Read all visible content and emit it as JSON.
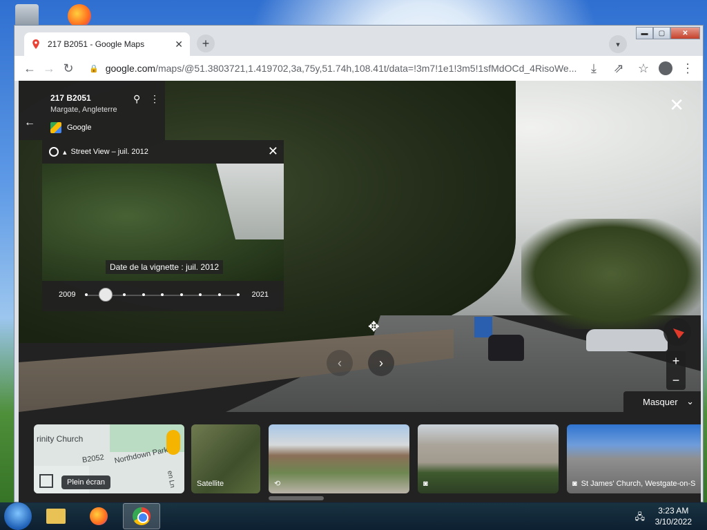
{
  "browser": {
    "tab_title": "217 B2051 - Google Maps",
    "tab_close": "✕",
    "new_tab": "+",
    "tab_search": "▾",
    "url_host": "google.com",
    "url_path": "/maps/@51.3803721,1.419702,3a,75y,51.74h,108.41t/data=!3m7!1e1!3m5!1sfMdOCd_4RisoWe...",
    "back": "←",
    "forward": "→",
    "reload": "↻",
    "lock": "🔒",
    "install": "⤓",
    "share": "⇗",
    "bookmark": "☆",
    "menu": "⋮",
    "win_min": "▬",
    "win_max": "▢",
    "win_close": "✕"
  },
  "info_panel": {
    "address": "217 B2051",
    "city": "Margate, Angleterre",
    "source": "Google",
    "back": "←",
    "pin": "⚲",
    "more": "⋮"
  },
  "timeline": {
    "header": "Street View – juil. 2012",
    "caret": "▴",
    "close": "✕",
    "caption": "Date de la vignette : juil. 2012",
    "year_start": "2009",
    "year_end": "2021",
    "dot_count": 9,
    "selected_index": 1
  },
  "viewer": {
    "close": "✕",
    "move": "✥",
    "prev": "‹",
    "next": "›",
    "zoom_in": "+",
    "zoom_out": "−",
    "hide_label": "Masquer",
    "hide_icon": "⌄"
  },
  "strip": {
    "map_label1": "rinity Church",
    "map_label2": "B2052",
    "map_label3": "Northdown Park R",
    "map_label4": "en Ln",
    "fullscreen_tooltip": "Plein écran",
    "satellite_label": "Satellite",
    "photo3_label": "St James' Church, Westgate-on-S",
    "camera": "◙",
    "pano360": "⟲"
  },
  "taskbar": {
    "time": "3:23 AM",
    "date": "3/10/2022",
    "network": "🖧"
  }
}
